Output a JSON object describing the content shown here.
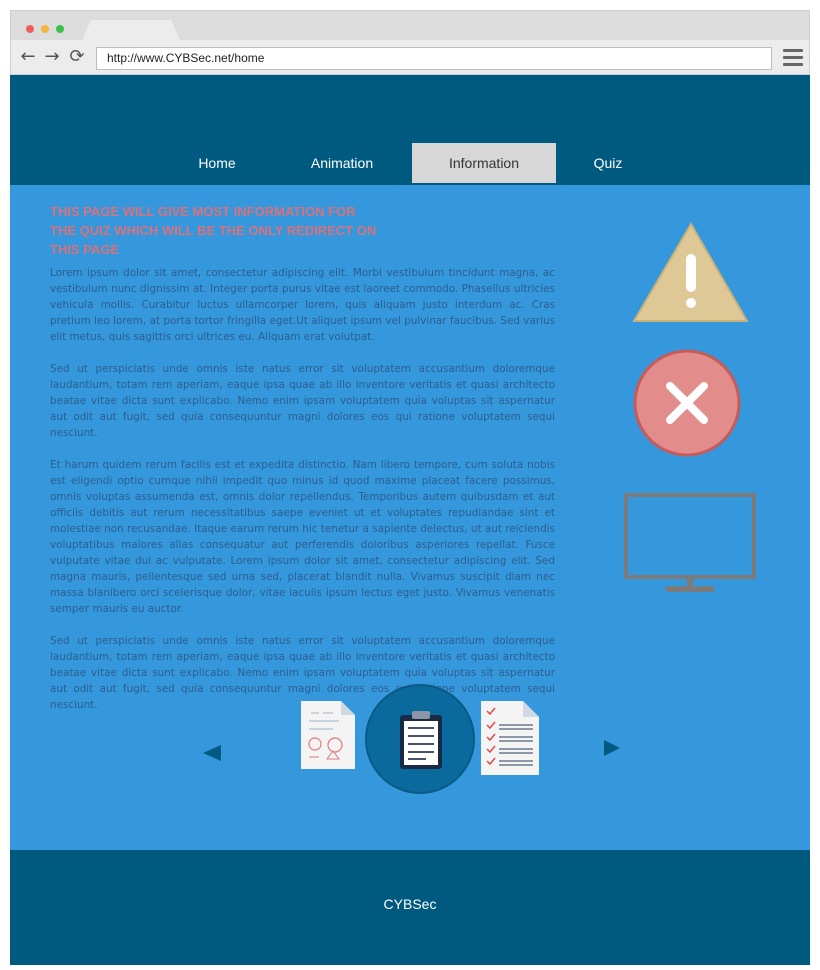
{
  "browser": {
    "url": "http://www.CYBSec.net/home",
    "traffic_colors": [
      "#ee5f5b",
      "#f5b53f",
      "#39c04a"
    ]
  },
  "nav": {
    "items": [
      {
        "label": "Home"
      },
      {
        "label": "Animation"
      },
      {
        "label": "Information"
      },
      {
        "label": "Quiz"
      }
    ],
    "active": "Information"
  },
  "content": {
    "lead": "THIS PAGE WILL GIVE MOST INFORMATION FOR THE QUIZ WHICH WILL BE THE ONLY REDIRECT ON THIS PAGE",
    "paragraphs": [
      "Lorem ipsum dolor sit amet, consectetur adipiscing elit. Morbi vestibulum tincidunt magna, ac vestibulum nunc dignissim at. Integer porta purus vitae est laoreet commodo. Phasellus ultricies vehicula mollis. Curabitur luctus ullamcorper lorem, quis aliquam justo interdum ac. Cras pretium leo lorem, at porta tortor fringilla eget.Ut aliquet ipsum vel pulvinar faucibus. Sed varius elit metus, quis sagittis orci ultrices eu. Aliquam erat volutpat.",
      "Sed ut perspiciatis unde omnis iste natus error sit voluptatem accusantium doloremque laudantium, totam rem aperiam, eaque ipsa quae ab illo inventore veritatis et quasi architecto beatae vitae dicta sunt explicabo. Nemo enim ipsam voluptatem quia voluptas sit aspernatur aut odit aut fugit, sed quia consequuntur magni dolores eos qui ratione voluptatem sequi nesciunt.",
      "Et harum quidem rerum facilis est et expedita distinctio. Nam libero tempore, cum soluta nobis est eligendi optio cumque nihil impedit quo minus id quod maxime placeat facere possimus, omnis voluptas assumenda est, omnis dolor repellendus. Temporibus autem quibusdam et aut officiis debitis aut rerum necessitatibus saepe eveniet ut et voluptates repudiandae sint et molestiae non recusandae. Itaque earum rerum hic tenetur a sapiente delectus, ut aut reiciendis voluptatibus maiores alias consequatur aut perferendis doloribus asperiores repellat. Fusce vulputate vitae dui ac vulputate. Lorem ipsum dolor sit amet, consectetur adipiscing elit. Sed magna mauris, pellentesque sed urna sed, placerat blandit nulla. Vivamus suscipit diam nec massa blanibero orci scelerisque dolor, vitae iaculis ipsum lectus eget justo. Vivamus venenatis semper mauris eu auctor.",
      "Sed ut perspiciatis unde omnis iste natus error sit voluptatem accusantium doloremque laudantium, totam rem aperiam, eaque ipsa quae ab illo inventore veritatis et quasi architecto beatae vitae dicta sunt explicabo. Nemo enim ipsam voluptatem quia voluptas sit aspernatur aut odit aut fugit, sed quia consequuntur magni dolores eos qui ratione voluptatem sequi nesciunt."
    ]
  },
  "icons": {
    "side": [
      "warning-icon",
      "error-icon",
      "monitor-icon"
    ],
    "carousel": [
      "worksheet-icon",
      "clipboard-icon",
      "checklist-icon"
    ]
  },
  "colors": {
    "header": "#005a80",
    "main": "#3597dc",
    "lead_text": "#d9727a",
    "active_tab": "#d7d7d7"
  },
  "footer": {
    "brand": "CYBSec"
  }
}
